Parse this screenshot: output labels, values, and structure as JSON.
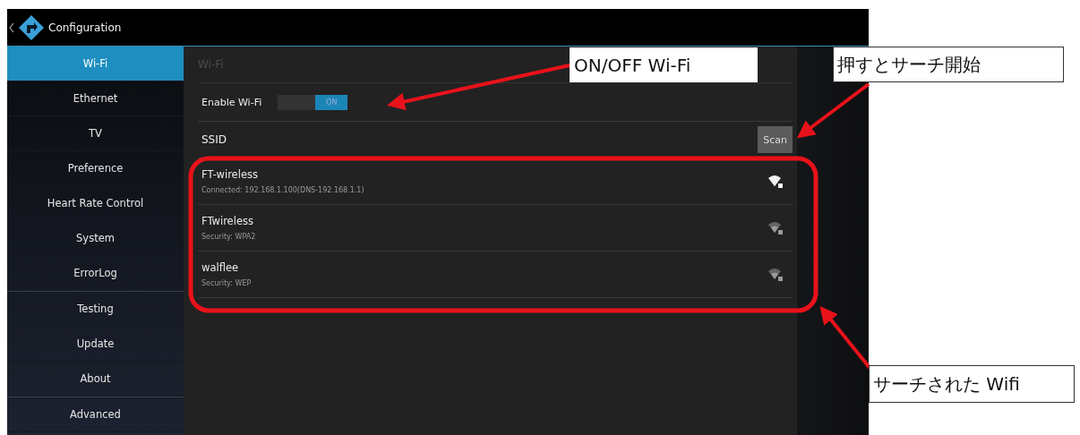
{
  "window": {
    "title": "Configuration"
  },
  "sidebar": {
    "groups": [
      {
        "items": [
          {
            "label": "Wi-Fi",
            "selected": true
          },
          {
            "label": "Ethernet",
            "selected": false
          },
          {
            "label": "TV",
            "selected": false
          },
          {
            "label": "Preference",
            "selected": false
          },
          {
            "label": "Heart Rate Control",
            "selected": false
          },
          {
            "label": "System",
            "selected": false
          },
          {
            "label": "ErrorLog",
            "selected": false
          }
        ]
      },
      {
        "items": [
          {
            "label": "Testing",
            "selected": false
          },
          {
            "label": "Update",
            "selected": false
          },
          {
            "label": "About",
            "selected": false
          }
        ]
      },
      {
        "items": [
          {
            "label": "Advanced",
            "selected": false
          }
        ]
      }
    ]
  },
  "panel": {
    "title": "Wi-Fi",
    "enable_wifi": {
      "label": "Enable Wi-Fi",
      "on": true,
      "state_label": "ON"
    },
    "ssid": {
      "label": "SSID",
      "button": "Scan"
    },
    "networks": [
      {
        "name": "FT-wireless",
        "detail": "Connected: 192.168.1.100(DNS-192.168.1.1)",
        "connected": true
      },
      {
        "name": "FTwireless",
        "detail": "Security: WPA2",
        "connected": false
      },
      {
        "name": "walflee",
        "detail": "Security: WEP",
        "connected": false
      }
    ]
  },
  "annotations": [
    {
      "text": "ON/OFF Wi-Fi"
    },
    {
      "text": "押すとサーチ開始"
    },
    {
      "text": "サーチされた Wifi"
    }
  ]
}
